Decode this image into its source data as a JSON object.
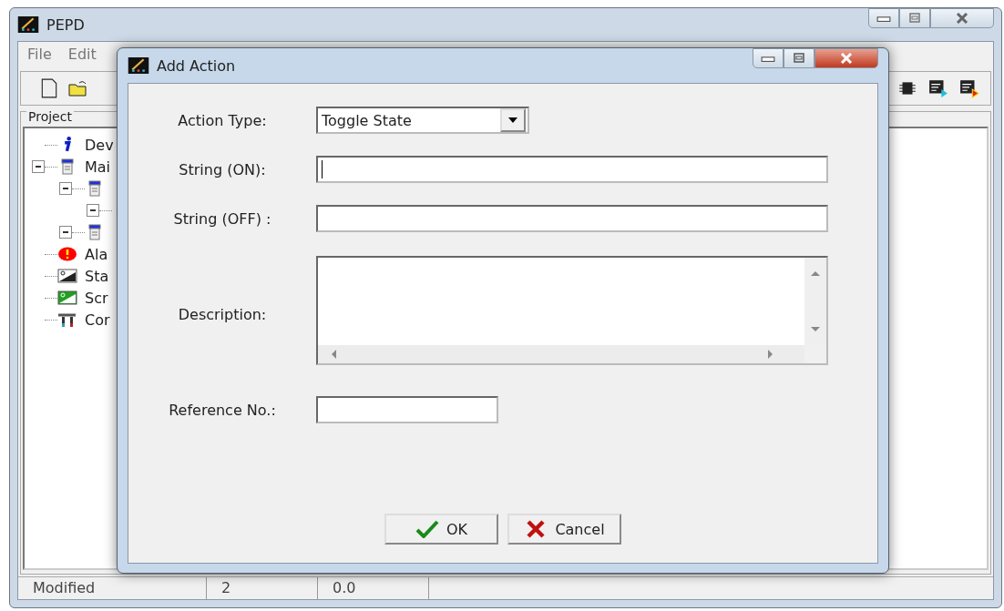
{
  "window": {
    "title": "PEPD"
  },
  "menu": [
    "File",
    "Edit"
  ],
  "project": {
    "title": "Project",
    "tree": [
      {
        "label": "Dev",
        "kind": "info"
      },
      {
        "label": "Mai",
        "kind": "form",
        "expanded": true,
        "children": [
          {
            "kind": "form",
            "expanded": true,
            "children": [
              {
                "expanded": true
              }
            ]
          },
          {
            "kind": "form",
            "expanded": true
          }
        ]
      },
      {
        "label": "Ala",
        "kind": "alarm"
      },
      {
        "label": "Sta",
        "kind": "picture"
      },
      {
        "label": "Scr",
        "kind": "picture-green"
      },
      {
        "label": "Cor",
        "kind": "tools"
      }
    ]
  },
  "status_bar": [
    "Modified",
    "2",
    "0.0"
  ],
  "dialog": {
    "title": "Add Action",
    "action_type": {
      "label": "Action Type:",
      "value": "Toggle State"
    },
    "string_on": {
      "label": "String (ON):",
      "focused": true
    },
    "string_off": {
      "label": "String (OFF) :"
    },
    "description": {
      "label": "Description:"
    },
    "reference_no": {
      "label": "Reference No.:"
    },
    "buttons": [
      {
        "kind": "ok",
        "label": "OK"
      },
      {
        "kind": "cancel",
        "label": "Cancel"
      }
    ]
  }
}
